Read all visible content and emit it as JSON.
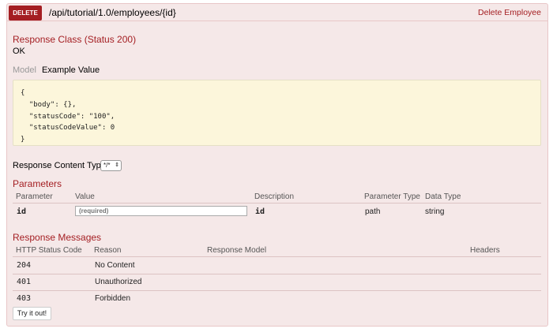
{
  "operation": {
    "method": "DELETE",
    "path": "/api/tutorial/1.0/employees/{id}",
    "summary": "Delete Employee",
    "method_color": "#a41e22"
  },
  "response_class": {
    "title": "Response Class (Status 200)",
    "status": "OK"
  },
  "signature_tabs": {
    "model": "Model",
    "example": "Example Value",
    "active": "Example Value"
  },
  "example_value": "{\n  \"body\": {},\n  \"statusCode\": \"100\",\n  \"statusCodeValue\": 0\n}",
  "response_content_type": {
    "label": "Response Content Type",
    "selected": "*/*"
  },
  "parameters": {
    "title": "Parameters",
    "headers": [
      "Parameter",
      "Value",
      "Description",
      "Parameter Type",
      "Data Type"
    ],
    "rows": [
      {
        "name": "id",
        "placeholder": "(required)",
        "description": "id",
        "param_type": "path",
        "data_type": "string"
      }
    ]
  },
  "response_messages": {
    "title": "Response Messages",
    "headers": [
      "HTTP Status Code",
      "Reason",
      "Response Model",
      "Headers"
    ],
    "rows": [
      {
        "code": "204",
        "reason": "No Content"
      },
      {
        "code": "401",
        "reason": "Unauthorized"
      },
      {
        "code": "403",
        "reason": "Forbidden"
      }
    ]
  },
  "try_button": "Try it out!"
}
